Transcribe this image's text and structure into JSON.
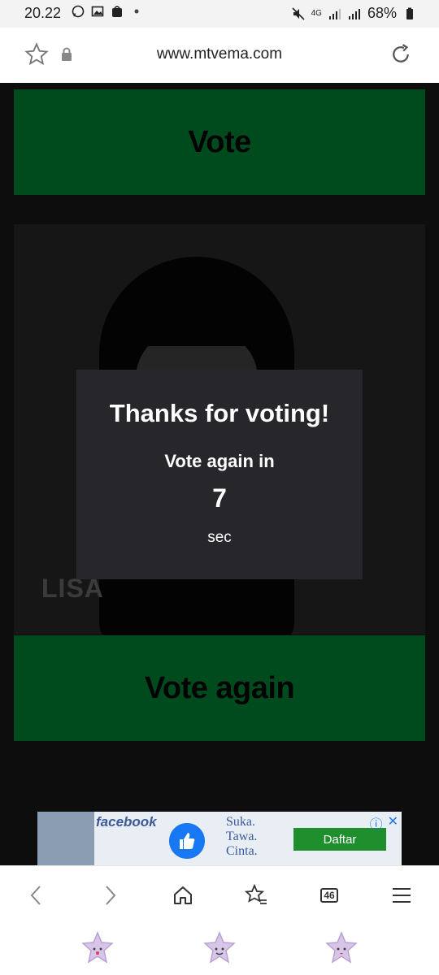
{
  "status_bar": {
    "time": "20.22",
    "battery": "68%",
    "network": "4G",
    "left_icons": [
      "whatsapp-icon",
      "image-icon",
      "shop-icon",
      "dot-icon"
    ],
    "right_icons": [
      "mute-icon",
      "signal-icon",
      "signal-icon",
      "battery-icon"
    ]
  },
  "browser": {
    "url": "www.mtvema.com",
    "tab_count": "46"
  },
  "page": {
    "vote_label": "Vote",
    "artist_name": "LISA",
    "vote_again_label": "Vote again"
  },
  "modal": {
    "title": "Thanks for voting!",
    "subtitle": "Vote again in",
    "countdown": "7",
    "unit": "sec"
  },
  "ad": {
    "brand": "facebook",
    "slogan_line1": "Suka.",
    "slogan_line2": "Tawa.",
    "slogan_line3": "Cinta.",
    "cta": "Daftar"
  },
  "colors": {
    "vote_green": "#00732f",
    "modal_bg": "#26262b",
    "page_bg": "#141414"
  }
}
